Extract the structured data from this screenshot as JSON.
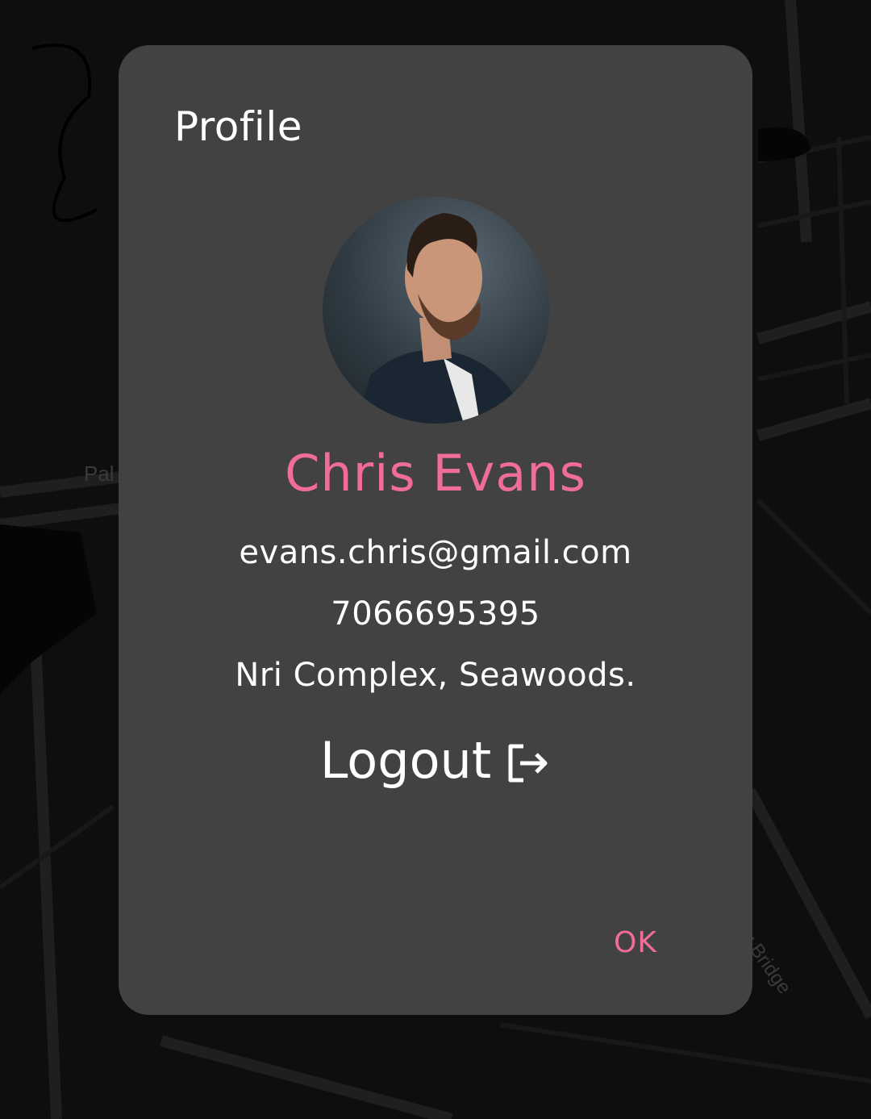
{
  "map": {
    "label_left": "Pal",
    "label_bridge": "apur Bridge"
  },
  "dialog": {
    "title": "Profile",
    "avatar_alt": "profile-photo",
    "name": "Chris Evans",
    "email": "evans.chris@gmail.com",
    "phone": "7066695395",
    "address": "Nri Complex, Seawoods.",
    "logout_label": "Logout",
    "logout_icon": "logout-icon",
    "ok_label": "OK"
  },
  "colors": {
    "accent": "#f06c9b",
    "dialog_bg": "#424242",
    "backdrop": "#0b0b0b",
    "text": "#ffffff"
  }
}
